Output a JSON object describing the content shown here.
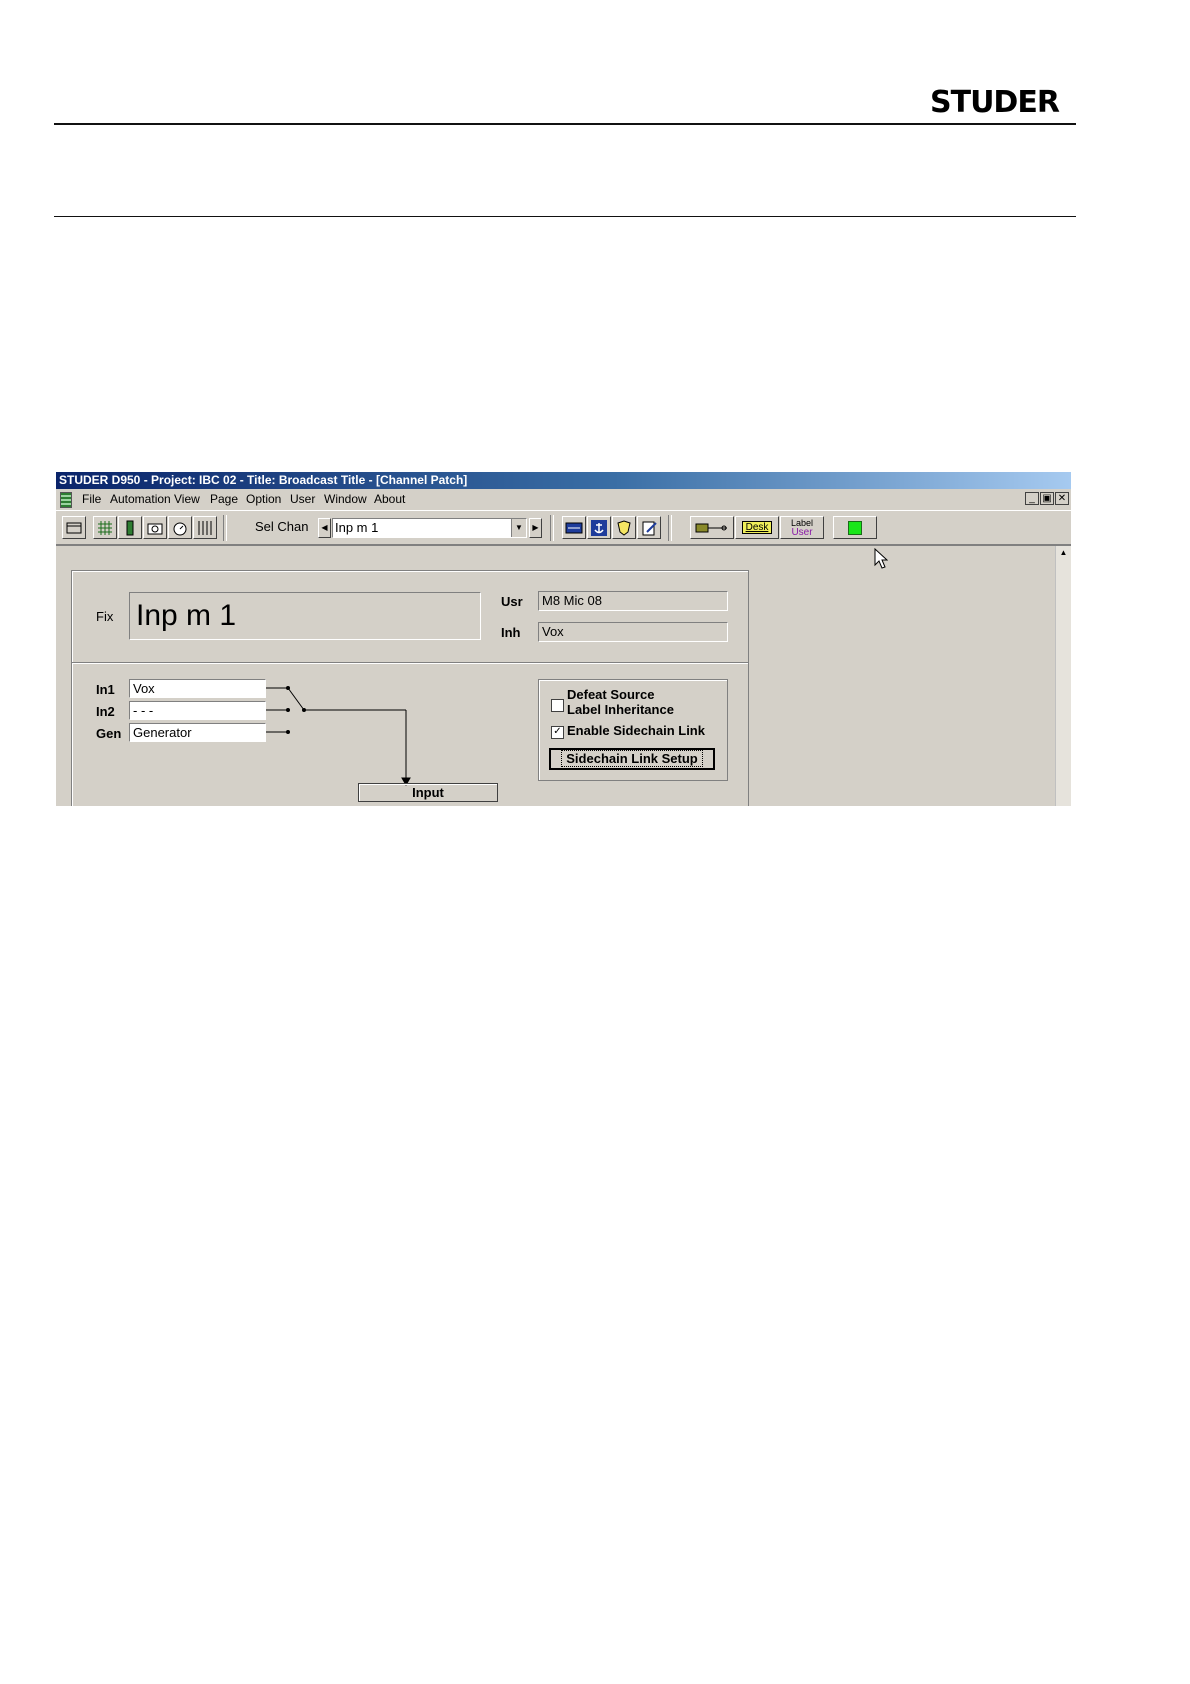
{
  "header": {
    "logo": "STUDER"
  },
  "window": {
    "title": "STUDER D950 - Project: IBC 02 - Title: Broadcast Title - [Channel Patch]",
    "menu": [
      "File",
      "Automation",
      "View",
      "Page",
      "Option",
      "User",
      "Window",
      "About"
    ],
    "mdi_buttons": [
      "_",
      "▣",
      "✕"
    ]
  },
  "toolbar": {
    "sel_chan_label": "Sel Chan",
    "sel_chan_value": "Inp m  1",
    "desk_label": "Desk",
    "label_user_top": "Label",
    "label_user_bottom": "User",
    "status_color": "#19e619"
  },
  "patch": {
    "fix_label": "Fix",
    "fix_value": "Inp m  1",
    "usr_label": "Usr",
    "usr_value": "M8  Mic 08",
    "inh_label": "Inh",
    "inh_value": "Vox",
    "inputs": [
      {
        "label": "In1",
        "value": "Vox"
      },
      {
        "label": "In2",
        "value": "- - -"
      },
      {
        "label": "Gen",
        "value": "Generator"
      }
    ],
    "options": {
      "defeat_line1": "Defeat Source",
      "defeat_line2": "Label Inheritance",
      "defeat_checked": false,
      "sidechain_label": "Enable Sidechain Link",
      "sidechain_checked": true,
      "setup_button": "Sidechain Link Setup"
    },
    "input_block": "Input"
  }
}
